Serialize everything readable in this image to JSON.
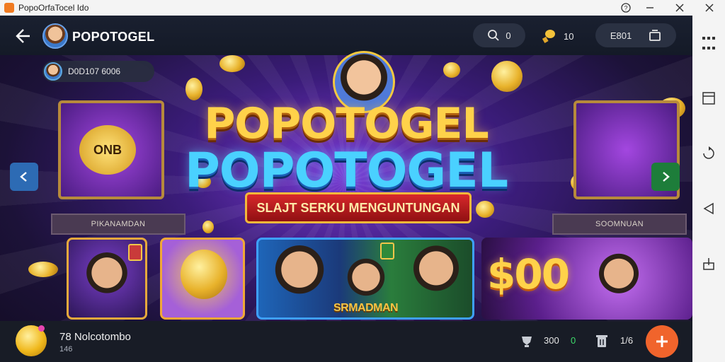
{
  "window": {
    "title": "PopoOrfaTocel Ido"
  },
  "header": {
    "brand": "POPOTOGEL",
    "search_count": "0",
    "coins": "10",
    "balance": "E801"
  },
  "user": {
    "id": "D0D107 6006"
  },
  "hero": {
    "logo_top": "POPOTOGEL",
    "logo_bottom": "POPOTOGEL",
    "ribbon": "SLAJT SERKU MENGUNTUNGAN"
  },
  "stages": {
    "left_medal": "ONB",
    "left_plate": "PIKANAMDAN",
    "right_plate": "SOOMNUAN"
  },
  "tiles": {
    "t3_label": "SRMADMAN",
    "t4_big": "$00"
  },
  "bottom": {
    "name": "78 Nolcotombo",
    "sub": "146",
    "stat1_value": "300",
    "stat1_extra": "0",
    "stat2_value": "1/6"
  },
  "colors": {
    "accent_orange": "#f0642c",
    "nav_left": "#2d6bb4",
    "nav_right": "#1d7d3a",
    "gold": "#ffd24a"
  }
}
